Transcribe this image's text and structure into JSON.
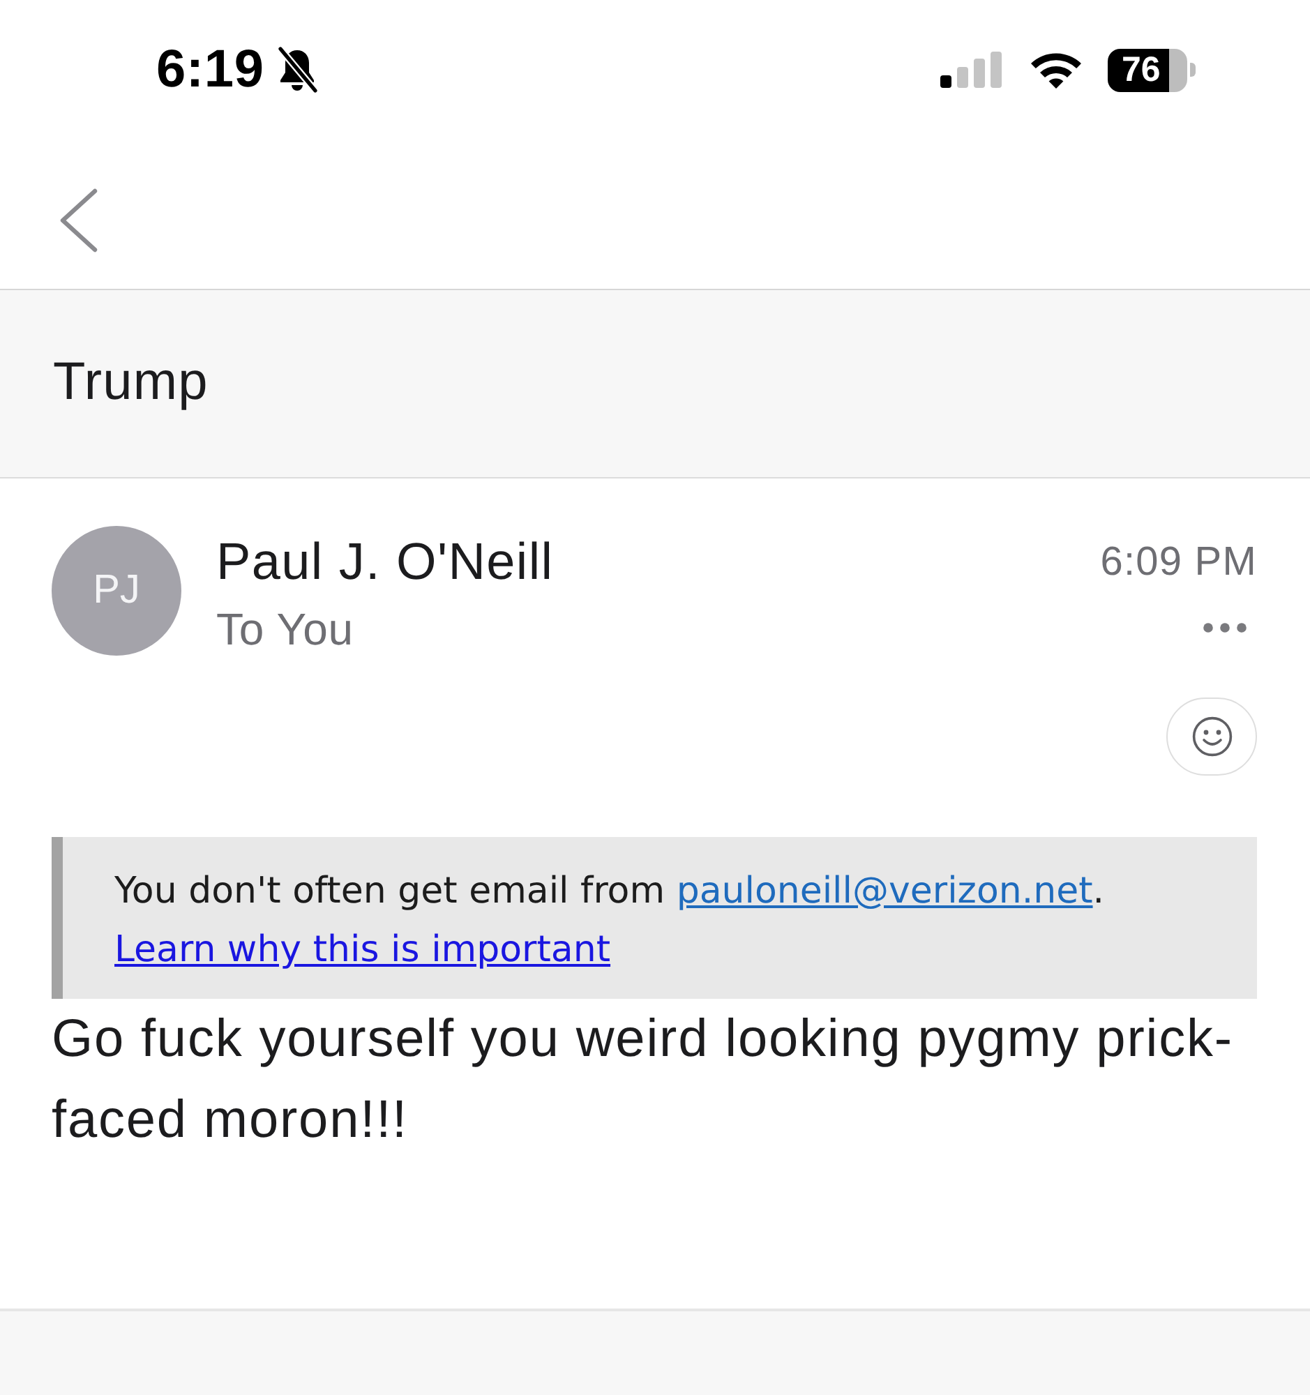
{
  "status_bar": {
    "time": "6:19",
    "silent": true,
    "battery": "76"
  },
  "subject": "Trump",
  "message": {
    "sender": {
      "initials": "PJ",
      "name": "Paul J. O'Neill"
    },
    "recipient": "To You",
    "time": "6:09 PM",
    "notice": {
      "text": "You don't often get email from ",
      "email": "pauloneill@verizon.net",
      "after": ".",
      "link": "Learn why this is important"
    },
    "body": "Go fuck yourself you weird looking pygmy prick-faced moron!!!"
  }
}
